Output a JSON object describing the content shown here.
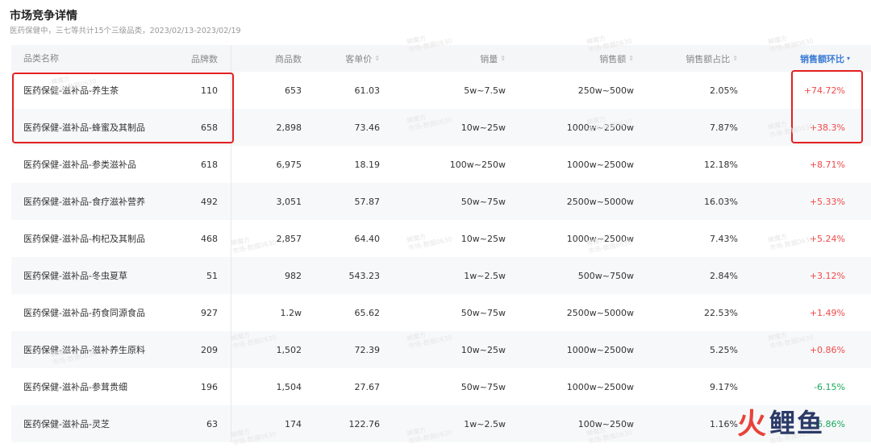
{
  "page": {
    "title": "市场竞争详情",
    "subtitle": "医药保健中，三七等共计15个三级品类，2023/02/13-2023/02/19"
  },
  "columns": [
    {
      "label": "品类名称",
      "sort": ""
    },
    {
      "label": "品牌数",
      "sort": ""
    },
    {
      "label": "商品数",
      "sort": ""
    },
    {
      "label": "客单价",
      "sort": "⇕"
    },
    {
      "label": "销量",
      "sort": "⇕"
    },
    {
      "label": "销售额",
      "sort": "⇕"
    },
    {
      "label": "销售额占比",
      "sort": "⇕"
    },
    {
      "label": "销售额环比",
      "sort": "▾"
    }
  ],
  "rows": [
    {
      "name": "医药保健-滋补品-养生茶",
      "brands": "110",
      "products": "653",
      "price": "61.03",
      "volume": "5w~7.5w",
      "sales": "250w~500w",
      "share": "2.05%",
      "mom": "+74.72%"
    },
    {
      "name": "医药保健-滋补品-蜂蜜及其制品",
      "brands": "658",
      "products": "2,898",
      "price": "73.46",
      "volume": "10w~25w",
      "sales": "1000w~2500w",
      "share": "7.87%",
      "mom": "+38.3%"
    },
    {
      "name": "医药保健-滋补品-参类滋补品",
      "brands": "618",
      "products": "6,975",
      "price": "18.19",
      "volume": "100w~250w",
      "sales": "1000w~2500w",
      "share": "12.18%",
      "mom": "+8.71%"
    },
    {
      "name": "医药保健-滋补品-食疗滋补营养",
      "brands": "492",
      "products": "3,051",
      "price": "57.87",
      "volume": "50w~75w",
      "sales": "2500w~5000w",
      "share": "16.03%",
      "mom": "+5.33%"
    },
    {
      "name": "医药保健-滋补品-枸杞及其制品",
      "brands": "468",
      "products": "2,857",
      "price": "64.40",
      "volume": "10w~25w",
      "sales": "1000w~2500w",
      "share": "7.43%",
      "mom": "+5.24%"
    },
    {
      "name": "医药保健-滋补品-冬虫夏草",
      "brands": "51",
      "products": "982",
      "price": "543.23",
      "volume": "1w~2.5w",
      "sales": "500w~750w",
      "share": "2.84%",
      "mom": "+3.12%"
    },
    {
      "name": "医药保健-滋补品-药食同源食品",
      "brands": "927",
      "products": "1.2w",
      "price": "65.62",
      "volume": "50w~75w",
      "sales": "2500w~5000w",
      "share": "22.53%",
      "mom": "+1.49%"
    },
    {
      "name": "医药保健-滋补品-滋补养生原料",
      "brands": "209",
      "products": "1,502",
      "price": "72.39",
      "volume": "10w~25w",
      "sales": "1000w~2500w",
      "share": "5.25%",
      "mom": "+0.86%"
    },
    {
      "name": "医药保健-滋补品-参茸贵细",
      "brands": "196",
      "products": "1,504",
      "price": "27.67",
      "volume": "50w~75w",
      "sales": "1000w~2500w",
      "share": "9.17%",
      "mom": "-6.15%"
    },
    {
      "name": "医药保健-滋补品-灵芝",
      "brands": "63",
      "products": "174",
      "price": "122.76",
      "volume": "1w~2.5w",
      "sales": "100w~250w",
      "share": "1.16%",
      "mom": "-6.86%"
    }
  ],
  "watermark": {
    "line1": "蝉魔方",
    "line2": "市场-数据0630"
  },
  "logo": {
    "mark": "火",
    "text": "鲤鱼"
  },
  "colors": {
    "positive": "#f04a4a",
    "negative": "#1aa85a",
    "highlight": "#e32020",
    "active_sort": "#3a7bd5"
  }
}
